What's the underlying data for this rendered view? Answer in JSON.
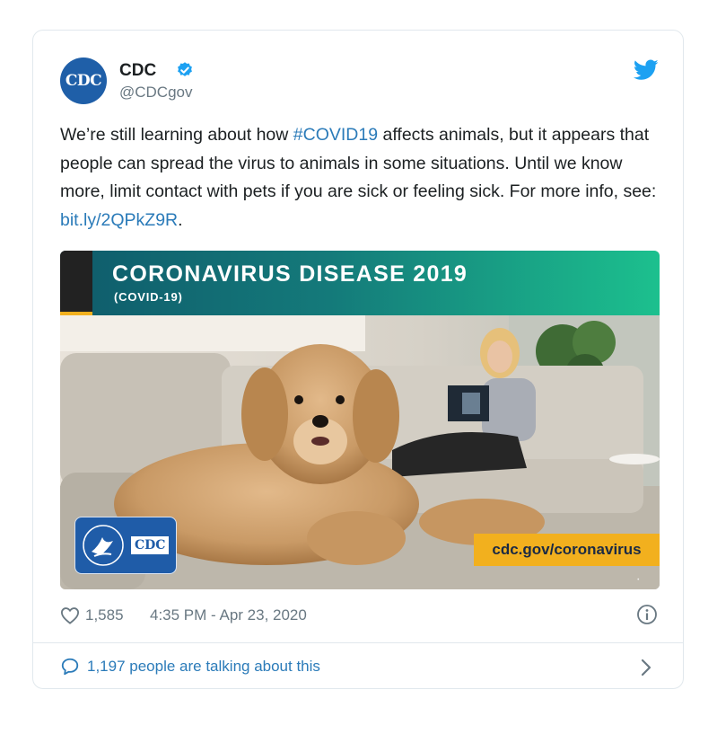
{
  "author": {
    "avatar_text": "CDC",
    "name": "CDC",
    "handle": "@CDCgov"
  },
  "tweet": {
    "text_1": "We’re still learning about how ",
    "hashtag": "#COVID19",
    "text_2": " affects animals, but it appears that people can spread the virus to animals in some situations. Until we know more, limit contact with pets if you are sick or feeling sick. For more info, see: ",
    "link": "bit.ly/2QPkZ9R",
    "text_3": "."
  },
  "media": {
    "banner_title": "CORONAVIRUS DISEASE 2019",
    "banner_subtitle": "(COVID-19)",
    "logo_text": "CDC",
    "url_label": "cdc.gov/coronavirus"
  },
  "meta": {
    "like_count": "1,585",
    "timestamp": "4:35 PM - Apr 23, 2020"
  },
  "footer": {
    "talking": "1,197 people are talking about this"
  },
  "colors": {
    "link": "#2b7bb9",
    "text": "#1c2022",
    "muted": "#697882",
    "verified": "#1da1f2",
    "banner_start": "#0f5b6b",
    "banner_end": "#1cc08e",
    "accent_yellow": "#f2b01e"
  }
}
